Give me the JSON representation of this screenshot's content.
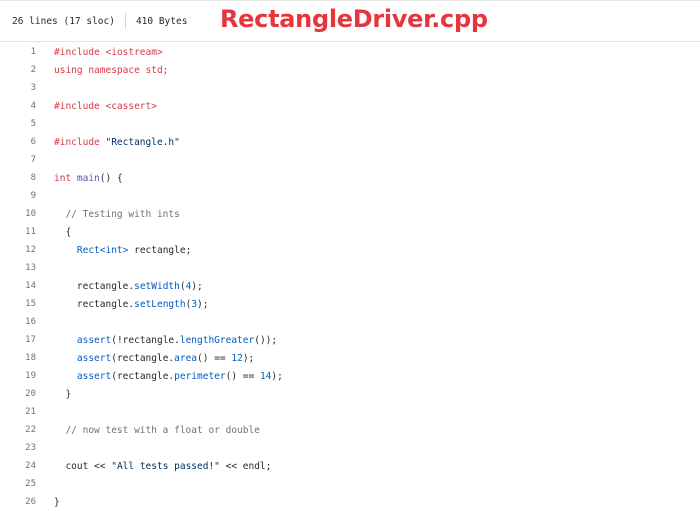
{
  "file_info": {
    "lines_text": "26 lines (17 sloc)",
    "size_text": "410 Bytes"
  },
  "file_title": "RectangleDriver.cpp",
  "code": {
    "l1": "#include <iostream>",
    "l2a": "using namespace",
    "l2b": " std;",
    "l4": "#include <cassert>",
    "l6a": "#include ",
    "l6b": "\"Rectangle.h\"",
    "l8a": "int ",
    "l8b": "main",
    "l8c": "() {",
    "l10": "// Testing with ints",
    "l11": "{",
    "l12a": "Rect<int>",
    "l12b": " rectangle;",
    "l14a": "rectangle.",
    "l14b": "setWidth",
    "l14c": "(",
    "l14d": "4",
    "l14e": ");",
    "l15a": "rectangle.",
    "l15b": "setLength",
    "l15c": "(",
    "l15d": "3",
    "l15e": ");",
    "l17a": "assert",
    "l17b": "(!rectangle.",
    "l17c": "lengthGreater",
    "l17d": "());",
    "l18a": "assert",
    "l18b": "(rectangle.",
    "l18c": "area",
    "l18d": "() == ",
    "l18e": "12",
    "l18f": ");",
    "l19a": "assert",
    "l19b": "(rectangle.",
    "l19c": "perimeter",
    "l19d": "() == ",
    "l19e": "14",
    "l19f": ");",
    "l20": "}",
    "l22": "// now test with a float or double",
    "l24a": "cout << ",
    "l24b": "\"All tests passed!\"",
    "l24c": " << endl;",
    "l26": "}"
  },
  "line_numbers": [
    "1",
    "2",
    "3",
    "4",
    "5",
    "6",
    "7",
    "8",
    "9",
    "10",
    "11",
    "12",
    "13",
    "14",
    "15",
    "16",
    "17",
    "18",
    "19",
    "20",
    "21",
    "22",
    "23",
    "24",
    "25",
    "26"
  ]
}
